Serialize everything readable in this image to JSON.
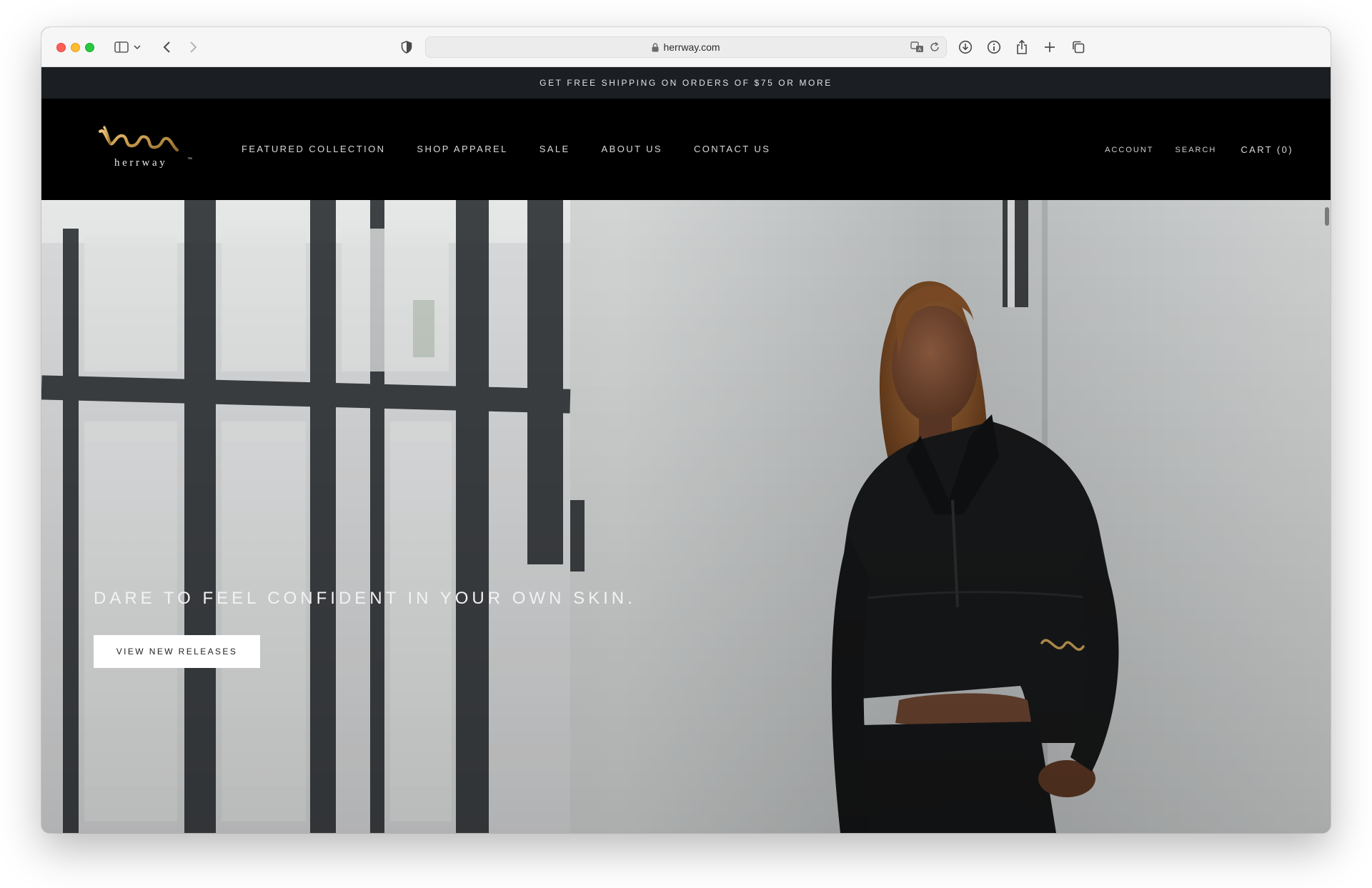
{
  "browser": {
    "url": "herrway.com",
    "icons": [
      "sidebar-icon",
      "chevron-down-icon",
      "back-icon",
      "forward-icon",
      "shield-icon",
      "lock-icon",
      "translate-icon",
      "reload-icon",
      "download-icon",
      "info-icon",
      "share-icon",
      "plus-icon",
      "tabs-icon"
    ]
  },
  "announcement": {
    "text": "GET FREE SHIPPING ON ORDERS OF $75 OR MORE"
  },
  "header": {
    "logo_text": "herrway",
    "logo_tm": "™",
    "nav": [
      {
        "label": "FEATURED COLLECTION"
      },
      {
        "label": "SHOP APPAREL"
      },
      {
        "label": "SALE"
      },
      {
        "label": "ABOUT US"
      },
      {
        "label": "CONTACT US"
      }
    ],
    "account_label": "ACCOUNT",
    "search_label": "SEARCH",
    "cart_label": "CART (0)"
  },
  "hero": {
    "title": "DARE TO FEEL CONFIDENT IN YOUR OWN SKIN.",
    "button_label": "VIEW NEW RELEASES"
  },
  "colors": {
    "announcement_bg": "#1b1e22",
    "header_bg": "#000000",
    "logo_gold": "#c79a4e",
    "hero_wall": "#b9bcbe"
  }
}
